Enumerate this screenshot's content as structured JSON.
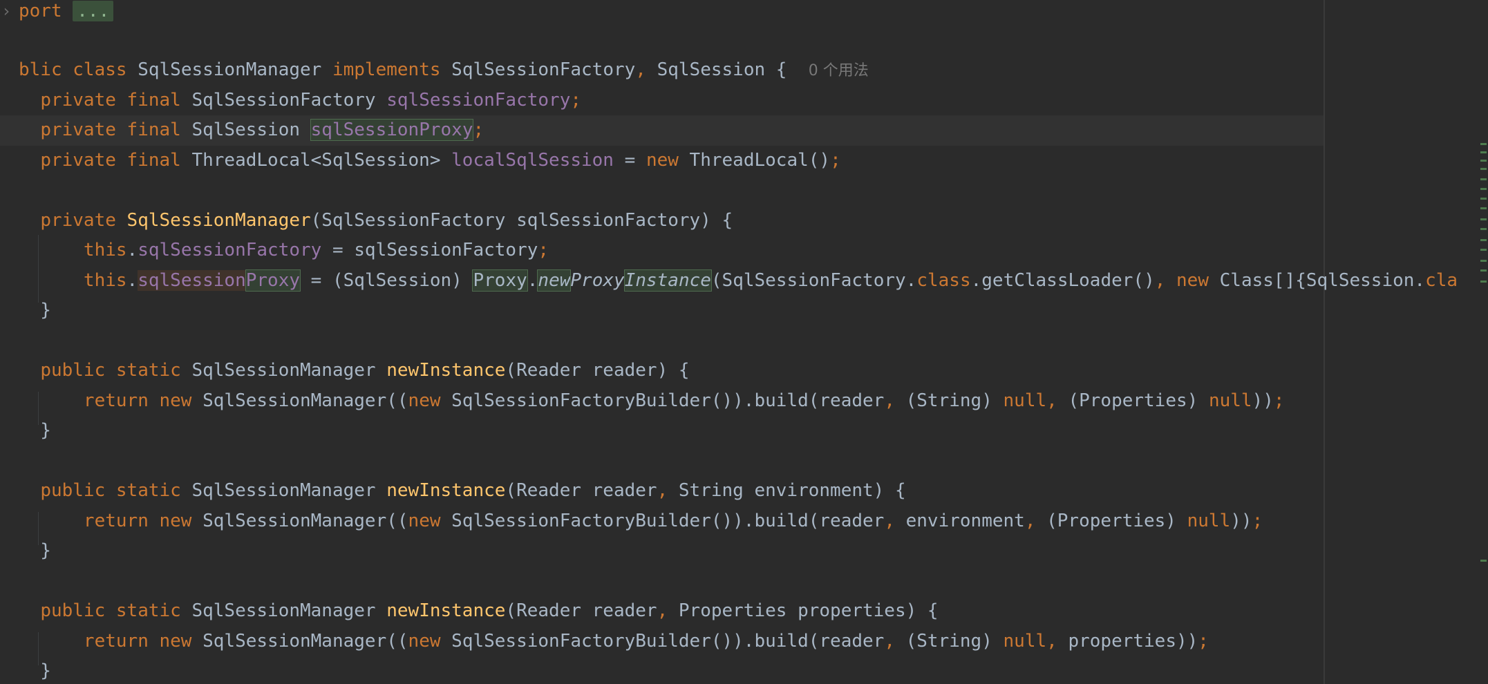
{
  "editor": {
    "language": "java",
    "fold_chip": "...",
    "lines": [
      {
        "text": "port"
      },
      {
        "text": ""
      },
      {
        "text": "blic class SqlSessionManager implements SqlSessionFactory, SqlSession {",
        "hint": "0 个用法"
      },
      {
        "text": "  private final SqlSessionFactory sqlSessionFactory;"
      },
      {
        "text": "  private final SqlSession sqlSessionProxy;"
      },
      {
        "text": "  private final ThreadLocal<SqlSession> localSqlSession = new ThreadLocal();"
      },
      {
        "text": ""
      },
      {
        "text": "  private SqlSessionManager(SqlSessionFactory sqlSessionFactory) {"
      },
      {
        "text": "      this.sqlSessionFactory = sqlSessionFactory;"
      },
      {
        "text": "      this.sqlSessionProxy = (SqlSession) Proxy.newProxyInstance(SqlSessionFactory.class.getClassLoader(), new Class[]{SqlSession.cla"
      },
      {
        "text": "  }"
      },
      {
        "text": ""
      },
      {
        "text": "  public static SqlSessionManager newInstance(Reader reader) {"
      },
      {
        "text": "      return new SqlSessionManager((new SqlSessionFactoryBuilder()).build(reader, (String) null, (Properties) null));"
      },
      {
        "text": "  }"
      },
      {
        "text": ""
      },
      {
        "text": "  public static SqlSessionManager newInstance(Reader reader, String environment) {"
      },
      {
        "text": "      return new SqlSessionManager((new SqlSessionFactoryBuilder()).build(reader, environment, (Properties) null));"
      },
      {
        "text": "  }"
      },
      {
        "text": ""
      },
      {
        "text": "  public static SqlSessionManager newInstance(Reader reader, Properties properties) {"
      },
      {
        "text": "      return new SqlSessionManager((new SqlSessionFactoryBuilder()).build(reader, (String) null, properties));"
      },
      {
        "text": "  }"
      }
    ]
  },
  "colors": {
    "background": "#2b2b2b",
    "keyword": "#cc7832",
    "field": "#9876aa",
    "method_declaration": "#ffc66d",
    "default_text": "#a9b7c6",
    "inlay_hint": "#787878",
    "usage_highlight": "#344134",
    "current_line": "#323232"
  },
  "icons": {
    "fold_arrow": "chevron-right-icon"
  }
}
